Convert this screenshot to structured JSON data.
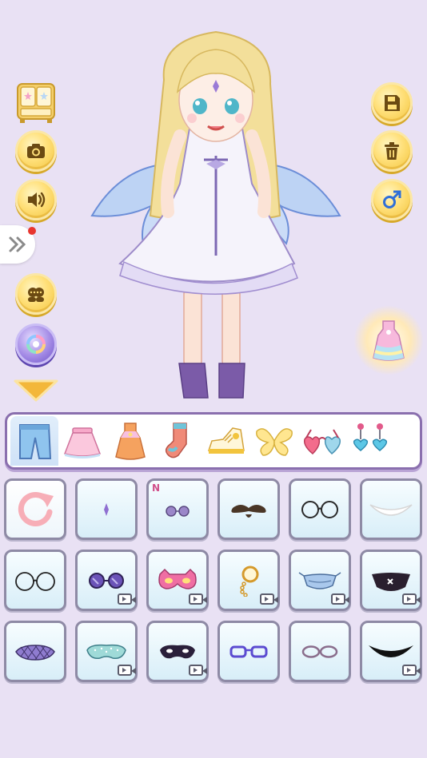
{
  "colors": {
    "background": "#e9e1f4",
    "gold_button": "#f2c43d",
    "category_border": "#8a6fae",
    "tile_bg": "#d8eef8"
  },
  "left_buttons": [
    {
      "icon": "wardrobe-icon"
    },
    {
      "icon": "camera-icon"
    },
    {
      "icon": "speaker-icon"
    },
    {
      "icon": "expand-arrows-icon",
      "notification_dot": true
    },
    {
      "icon": "faces-icon"
    },
    {
      "icon": "swirl-icon"
    },
    {
      "icon": "chevron-down-icon"
    }
  ],
  "right_buttons": [
    {
      "icon": "save-icon"
    },
    {
      "icon": "trash-icon"
    },
    {
      "icon": "male-symbol-icon"
    },
    {
      "icon": "dress-suggest-icon"
    }
  ],
  "categories": [
    {
      "name": "pants",
      "icon": "pants-icon",
      "selected": true
    },
    {
      "name": "skirt",
      "icon": "skirt-icon"
    },
    {
      "name": "dress",
      "icon": "dress-icon"
    },
    {
      "name": "socks",
      "icon": "sock-icon"
    },
    {
      "name": "shoes",
      "icon": "sneaker-icon"
    },
    {
      "name": "wings",
      "icon": "wings-icon"
    },
    {
      "name": "glasses",
      "icon": "heart-glasses-icon"
    },
    {
      "name": "earrings",
      "icon": "earrings-icon"
    }
  ],
  "items": {
    "new_badge": "N",
    "rows": [
      [
        {
          "icon": "reset-icon",
          "video": false
        },
        {
          "icon": "gem-icon",
          "video": false
        },
        {
          "icon": "sunglasses-small-icon",
          "video": false,
          "new": true
        },
        {
          "icon": "mustache-icon",
          "video": false
        },
        {
          "icon": "round-glasses-icon",
          "video": false
        },
        {
          "icon": "smile-mask-icon",
          "video": false
        }
      ],
      [
        {
          "icon": "thin-glasses-icon",
          "video": false
        },
        {
          "icon": "purple-sunglasses-icon",
          "video": true
        },
        {
          "icon": "cat-mask-icon",
          "video": true
        },
        {
          "icon": "monocle-icon",
          "video": true
        },
        {
          "icon": "face-mask-icon",
          "video": true
        },
        {
          "icon": "black-mask-icon",
          "video": true
        }
      ],
      [
        {
          "icon": "lace-mask-icon",
          "video": false
        },
        {
          "icon": "green-eye-mask-icon",
          "video": true
        },
        {
          "icon": "sleep-mask-icon",
          "video": true
        },
        {
          "icon": "blue-glasses-icon",
          "video": false
        },
        {
          "icon": "pink-glasses-icon",
          "video": false
        },
        {
          "icon": "black-smile-mask-icon",
          "video": true
        }
      ]
    ]
  }
}
